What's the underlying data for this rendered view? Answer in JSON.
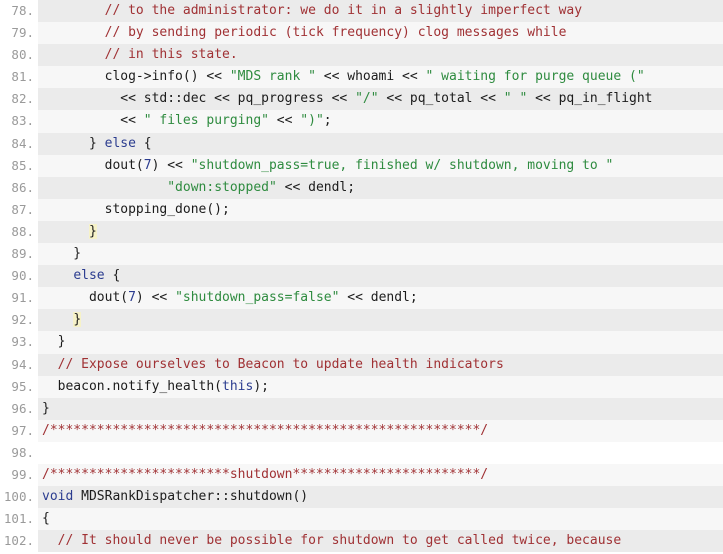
{
  "viewer": {
    "name": "source-code-viewer",
    "language": "C++",
    "first_line": 78,
    "last_line": 102,
    "colors": {
      "background": "#ffffff",
      "stripe_background": "#ebebeb",
      "plain_background": "#f7f7f7",
      "gutter_text": "#9a9a9a",
      "comment": "#a03134",
      "string": "#2e8b3f",
      "keyword": "#2b3c8f",
      "number": "#2b3c8f",
      "text": "#1c1c1c",
      "bracket_highlight": "#f6f2c8"
    }
  },
  "lines": [
    {
      "number": "78.",
      "stripe": true,
      "tokens": [
        {
          "t": "plain",
          "s": "        "
        },
        {
          "t": "comment",
          "s": "// to the administrator: we do it in a slightly imperfect way"
        }
      ]
    },
    {
      "number": "79.",
      "stripe": false,
      "tokens": [
        {
          "t": "plain",
          "s": "        "
        },
        {
          "t": "comment",
          "s": "// by sending periodic (tick frequency) clog messages while"
        }
      ]
    },
    {
      "number": "80.",
      "stripe": true,
      "tokens": [
        {
          "t": "plain",
          "s": "        "
        },
        {
          "t": "comment",
          "s": "// in this state."
        }
      ]
    },
    {
      "number": "81.",
      "stripe": false,
      "tokens": [
        {
          "t": "plain",
          "s": "        clog->info() << "
        },
        {
          "t": "string",
          "s": "\"MDS rank \""
        },
        {
          "t": "plain",
          "s": " << whoami << "
        },
        {
          "t": "string",
          "s": "\" waiting for purge queue (\""
        }
      ]
    },
    {
      "number": "82.",
      "stripe": true,
      "tokens": [
        {
          "t": "plain",
          "s": "          << std::dec << pq_progress << "
        },
        {
          "t": "string",
          "s": "\"/\""
        },
        {
          "t": "plain",
          "s": " << pq_total << "
        },
        {
          "t": "string",
          "s": "\" \""
        },
        {
          "t": "plain",
          "s": " << pq_in_flight"
        }
      ]
    },
    {
      "number": "83.",
      "stripe": false,
      "tokens": [
        {
          "t": "plain",
          "s": "          << "
        },
        {
          "t": "string",
          "s": "\" files purging\""
        },
        {
          "t": "plain",
          "s": " << "
        },
        {
          "t": "string",
          "s": "\")\""
        },
        {
          "t": "plain",
          "s": ";"
        }
      ]
    },
    {
      "number": "84.",
      "stripe": true,
      "tokens": [
        {
          "t": "plain",
          "s": "      } "
        },
        {
          "t": "keyword",
          "s": "else"
        },
        {
          "t": "plain",
          "s": " {"
        }
      ]
    },
    {
      "number": "85.",
      "stripe": false,
      "tokens": [
        {
          "t": "plain",
          "s": "        dout("
        },
        {
          "t": "number",
          "s": "7"
        },
        {
          "t": "plain",
          "s": ") << "
        },
        {
          "t": "string",
          "s": "\"shutdown_pass=true, finished w/ shutdown, moving to \""
        }
      ]
    },
    {
      "number": "86.",
      "stripe": true,
      "tokens": [
        {
          "t": "plain",
          "s": "                "
        },
        {
          "t": "string",
          "s": "\"down:stopped\""
        },
        {
          "t": "plain",
          "s": " << dendl;"
        }
      ]
    },
    {
      "number": "87.",
      "stripe": false,
      "tokens": [
        {
          "t": "plain",
          "s": "        stopping_done();"
        }
      ]
    },
    {
      "number": "88.",
      "stripe": true,
      "tokens": [
        {
          "t": "plain",
          "s": "      "
        },
        {
          "t": "brace-hl",
          "s": "}"
        }
      ]
    },
    {
      "number": "89.",
      "stripe": false,
      "tokens": [
        {
          "t": "plain",
          "s": "    }"
        }
      ]
    },
    {
      "number": "90.",
      "stripe": true,
      "tokens": [
        {
          "t": "plain",
          "s": "    "
        },
        {
          "t": "keyword",
          "s": "else"
        },
        {
          "t": "plain",
          "s": " {"
        }
      ]
    },
    {
      "number": "91.",
      "stripe": false,
      "tokens": [
        {
          "t": "plain",
          "s": "      dout("
        },
        {
          "t": "number",
          "s": "7"
        },
        {
          "t": "plain",
          "s": ") << "
        },
        {
          "t": "string",
          "s": "\"shutdown_pass=false\""
        },
        {
          "t": "plain",
          "s": " << dendl;"
        }
      ]
    },
    {
      "number": "92.",
      "stripe": true,
      "tokens": [
        {
          "t": "plain",
          "s": "    "
        },
        {
          "t": "brace-hl",
          "s": "}"
        }
      ]
    },
    {
      "number": "93.",
      "stripe": false,
      "tokens": [
        {
          "t": "plain",
          "s": "  }"
        }
      ]
    },
    {
      "number": "94.",
      "stripe": true,
      "tokens": [
        {
          "t": "plain",
          "s": "  "
        },
        {
          "t": "comment",
          "s": "// Expose ourselves to Beacon to update health indicators"
        }
      ]
    },
    {
      "number": "95.",
      "stripe": false,
      "tokens": [
        {
          "t": "plain",
          "s": "  beacon.notify_health("
        },
        {
          "t": "keyword",
          "s": "this"
        },
        {
          "t": "plain",
          "s": ");"
        }
      ]
    },
    {
      "number": "96.",
      "stripe": true,
      "tokens": [
        {
          "t": "plain",
          "s": "}"
        }
      ]
    },
    {
      "number": "97.",
      "stripe": false,
      "tokens": [
        {
          "t": "comment",
          "s": "/*******************************************************/"
        }
      ]
    },
    {
      "number": "98.",
      "stripe": true,
      "tokens": [
        {
          "t": "plain",
          "s": ""
        }
      ]
    },
    {
      "number": "99.",
      "stripe": false,
      "tokens": [
        {
          "t": "comment",
          "s": "/***********************shutdown************************/"
        }
      ]
    },
    {
      "number": "100.",
      "stripe": true,
      "tokens": [
        {
          "t": "keyword",
          "s": "void"
        },
        {
          "t": "plain",
          "s": " MDSRankDispatcher::shutdown()"
        }
      ]
    },
    {
      "number": "101.",
      "stripe": false,
      "tokens": [
        {
          "t": "plain",
          "s": "{"
        }
      ]
    },
    {
      "number": "102.",
      "stripe": true,
      "tokens": [
        {
          "t": "plain",
          "s": "  "
        },
        {
          "t": "comment",
          "s": "// It should never be possible for shutdown to get called twice, because"
        }
      ]
    }
  ]
}
